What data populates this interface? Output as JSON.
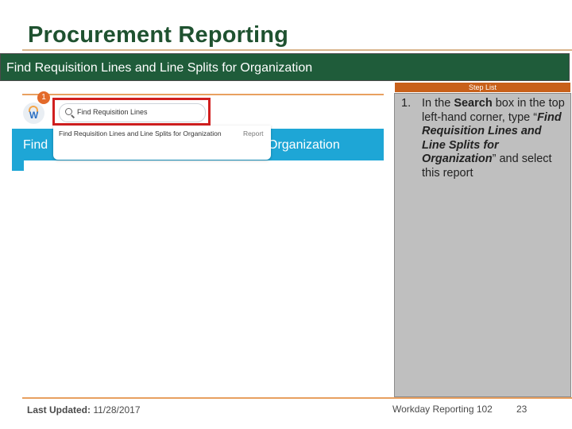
{
  "slide": {
    "title": "Procurement Reporting",
    "banner": "Find Requisition Lines and Line Splits for Organization"
  },
  "screenshot": {
    "badge": "1",
    "logo_letter": "W",
    "search_text": "Find Requisition Lines",
    "dropdown_item": "Find Requisition Lines and Line Splits for Organization",
    "dropdown_category": "Report",
    "band_left": "Find",
    "band_right": "Organization"
  },
  "steps": {
    "header": "Step List",
    "items": [
      {
        "num": "1.",
        "pre": "In the ",
        "bold": "Search",
        "mid": " box in the top left-hand corner, type “",
        "italic": "Find Requisition Lines and Line Splits for Organization",
        "post": "” and select this report"
      }
    ]
  },
  "footer": {
    "updated_label": "Last Updated:",
    "updated_value": " 11/28/2017",
    "course": "Workday Reporting 102",
    "page": "23"
  },
  "colors": {
    "title": "#1f5230",
    "banner": "#1f5c3a",
    "steplist_bar": "#c8601a",
    "panel": "#bfbfbf",
    "workday_blue": "#1ea6d6",
    "highlight_red": "#d11f1f"
  }
}
